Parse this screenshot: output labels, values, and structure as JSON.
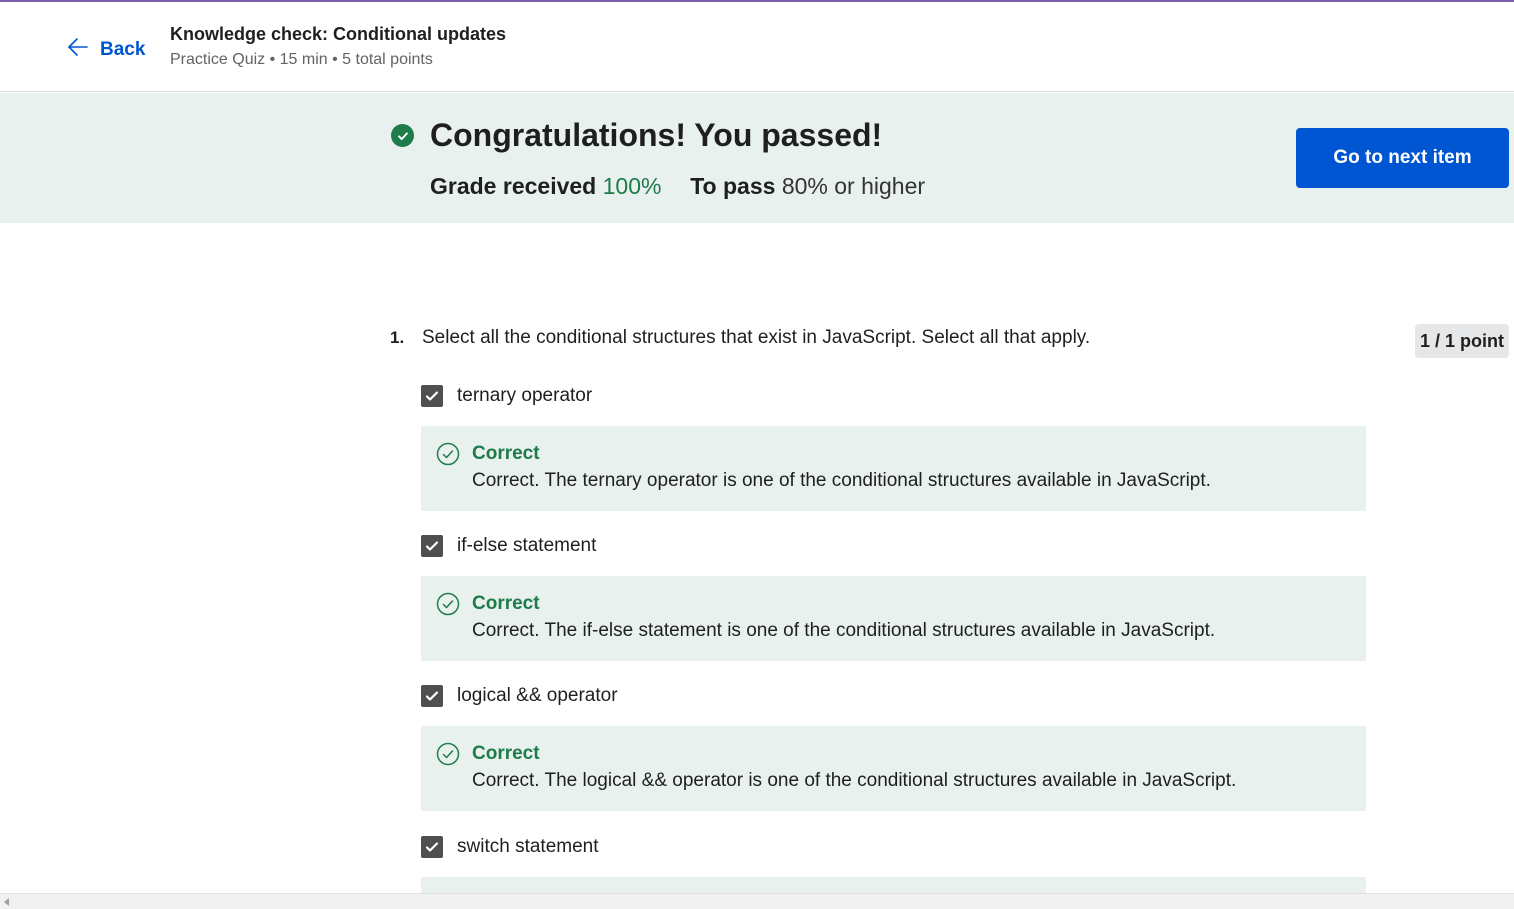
{
  "header": {
    "back_label": "Back",
    "title": "Knowledge check: Conditional updates",
    "meta": "Practice Quiz • 15 min • 5 total points"
  },
  "banner": {
    "congrats": "Congratulations! You passed!",
    "grade_label": "Grade received",
    "grade_value": "100%",
    "pass_label": "To pass",
    "pass_value": "80% or higher",
    "next_button": "Go to next item"
  },
  "question": {
    "number": "1.",
    "text": "Select all the conditional structures that exist in JavaScript. Select all that apply.",
    "points": "1 / 1 point",
    "options": [
      {
        "label": "ternary operator",
        "checked": true,
        "feedback_title": "Correct",
        "feedback_text": "Correct. The ternary operator is one of the conditional structures available in JavaScript."
      },
      {
        "label": "if-else statement",
        "checked": true,
        "feedback_title": "Correct",
        "feedback_text": "Correct. The if-else statement is one of the conditional structures available in JavaScript."
      },
      {
        "label": "logical && operator",
        "checked": true,
        "feedback_title": "Correct",
        "feedback_text": "Correct. The logical && operator is one of the conditional structures available in JavaScript."
      },
      {
        "label": "switch statement",
        "checked": true
      }
    ]
  },
  "colors": {
    "accent": "#0056d2",
    "success": "#1e7b4a",
    "banner_bg": "#e8f1ee"
  }
}
